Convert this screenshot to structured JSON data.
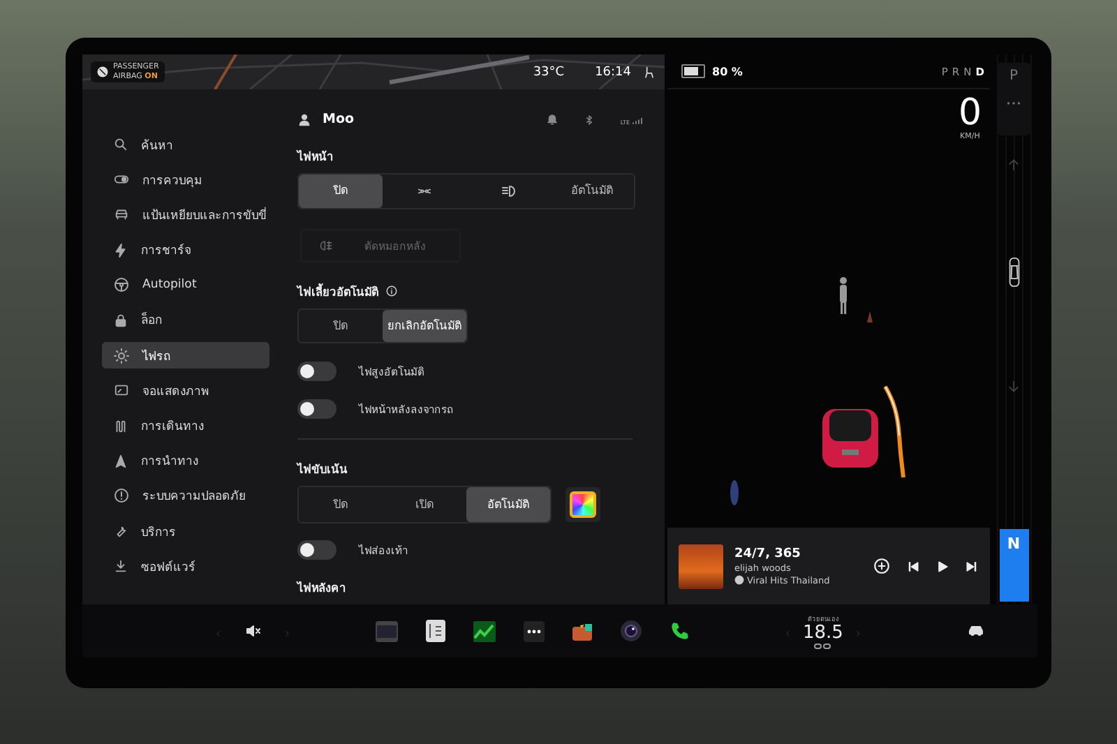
{
  "status": {
    "airbag_line1": "PASSENGER",
    "airbag_line2": "AIRBAG",
    "airbag_state": "ON",
    "temperature": "33°C",
    "time": "16:14"
  },
  "sidebar": {
    "items": [
      {
        "kind": "search",
        "label": "ค้นหา",
        "selected": false
      },
      {
        "kind": "controls",
        "label": "การควบคุม",
        "selected": false
      },
      {
        "kind": "pedals",
        "label": "แป้นเหยียบและการขับขี่",
        "selected": false
      },
      {
        "kind": "charging",
        "label": "การชาร์จ",
        "selected": false
      },
      {
        "kind": "autopilot",
        "label": "Autopilot",
        "selected": false
      },
      {
        "kind": "lock",
        "label": "ล็อก",
        "selected": false
      },
      {
        "kind": "lights",
        "label": "ไฟรถ",
        "selected": true
      },
      {
        "kind": "display",
        "label": "จอแสดงภาพ",
        "selected": false
      },
      {
        "kind": "trips",
        "label": "การเดินทาง",
        "selected": false
      },
      {
        "kind": "navigation",
        "label": "การนำทาง",
        "selected": false
      },
      {
        "kind": "safety",
        "label": "ระบบความปลอดภัย",
        "selected": false
      },
      {
        "kind": "service",
        "label": "บริการ",
        "selected": false
      },
      {
        "kind": "software",
        "label": "ซอฟต์แวร์",
        "selected": false
      }
    ]
  },
  "profile": {
    "name": "Moo",
    "network": "LTE"
  },
  "headlights": {
    "title": "ไฟหน้า",
    "options": [
      {
        "kind": "text",
        "label": "ปิด",
        "selected": true
      },
      {
        "kind": "parking",
        "selected": false
      },
      {
        "kind": "lowbeam",
        "selected": false
      },
      {
        "kind": "text",
        "label": "อัตโนมัติ",
        "selected": false
      }
    ]
  },
  "fog_button": {
    "label": "ตัดหมอกหลัง",
    "disabled": true
  },
  "turn_signals": {
    "title": "ไฟเลี้ยวอัตโนมัติ",
    "options": [
      {
        "kind": "text",
        "label": "ปิด",
        "selected": false
      },
      {
        "kind": "text",
        "label": "ยกเลิกอัตโนมัติ",
        "selected": true
      }
    ]
  },
  "toggles_1": [
    {
      "label": "ไฟสูงอัตโนมัติ",
      "on": false
    },
    {
      "label": "ไฟหน้าหลังลงจากรถ",
      "on": false
    }
  ],
  "ambient": {
    "title": "ไฟขับเน้น",
    "options": [
      {
        "kind": "text",
        "label": "ปิด",
        "selected": false
      },
      {
        "kind": "text",
        "label": "เปิด",
        "selected": false
      },
      {
        "kind": "text",
        "label": "อัตโนมัติ",
        "selected": true
      }
    ]
  },
  "toggles_2": [
    {
      "label": "ไฟส่องเท้า",
      "on": false
    }
  ],
  "next_section": {
    "title": "ไฟหลังคา"
  },
  "drive": {
    "battery": "80 %",
    "gears": [
      {
        "label": "P",
        "selected": false
      },
      {
        "label": "R",
        "selected": false
      },
      {
        "label": "N",
        "selected": false
      },
      {
        "label": "D",
        "selected": true
      }
    ],
    "speed": "0",
    "speed_unit": "KM/H",
    "park_button": "P",
    "current_gear": "N"
  },
  "media": {
    "title": "24/7, 365",
    "artist": "elijah woods",
    "source": "Viral Hits Thailand",
    "playing": false
  },
  "dock": {
    "muted": true,
    "climate_label": "ด้วยตนเอง",
    "temperature": "18.5"
  }
}
